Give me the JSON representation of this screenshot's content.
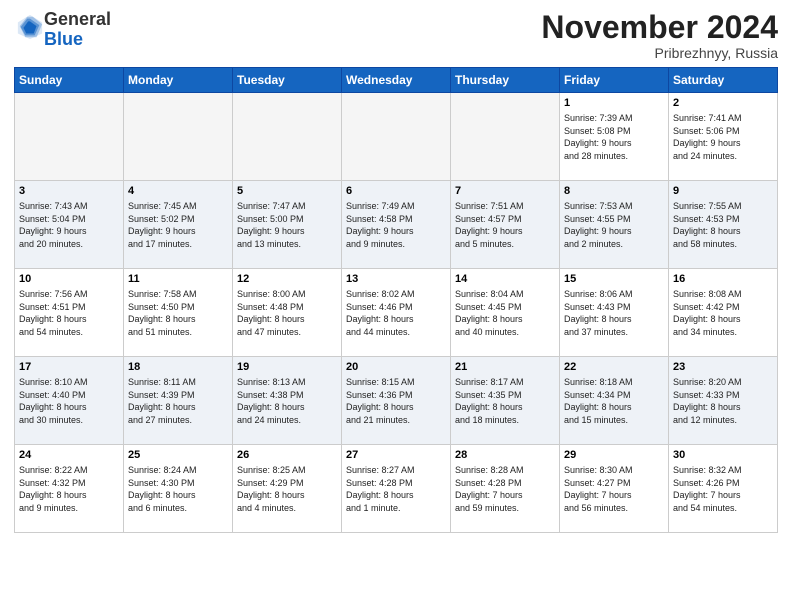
{
  "header": {
    "logo_general": "General",
    "logo_blue": "Blue",
    "month_title": "November 2024",
    "location": "Pribrezhnyy, Russia"
  },
  "weekdays": [
    "Sunday",
    "Monday",
    "Tuesday",
    "Wednesday",
    "Thursday",
    "Friday",
    "Saturday"
  ],
  "weeks": [
    [
      {
        "day": "",
        "info": ""
      },
      {
        "day": "",
        "info": ""
      },
      {
        "day": "",
        "info": ""
      },
      {
        "day": "",
        "info": ""
      },
      {
        "day": "",
        "info": ""
      },
      {
        "day": "1",
        "info": "Sunrise: 7:39 AM\nSunset: 5:08 PM\nDaylight: 9 hours\nand 28 minutes."
      },
      {
        "day": "2",
        "info": "Sunrise: 7:41 AM\nSunset: 5:06 PM\nDaylight: 9 hours\nand 24 minutes."
      }
    ],
    [
      {
        "day": "3",
        "info": "Sunrise: 7:43 AM\nSunset: 5:04 PM\nDaylight: 9 hours\nand 20 minutes."
      },
      {
        "day": "4",
        "info": "Sunrise: 7:45 AM\nSunset: 5:02 PM\nDaylight: 9 hours\nand 17 minutes."
      },
      {
        "day": "5",
        "info": "Sunrise: 7:47 AM\nSunset: 5:00 PM\nDaylight: 9 hours\nand 13 minutes."
      },
      {
        "day": "6",
        "info": "Sunrise: 7:49 AM\nSunset: 4:58 PM\nDaylight: 9 hours\nand 9 minutes."
      },
      {
        "day": "7",
        "info": "Sunrise: 7:51 AM\nSunset: 4:57 PM\nDaylight: 9 hours\nand 5 minutes."
      },
      {
        "day": "8",
        "info": "Sunrise: 7:53 AM\nSunset: 4:55 PM\nDaylight: 9 hours\nand 2 minutes."
      },
      {
        "day": "9",
        "info": "Sunrise: 7:55 AM\nSunset: 4:53 PM\nDaylight: 8 hours\nand 58 minutes."
      }
    ],
    [
      {
        "day": "10",
        "info": "Sunrise: 7:56 AM\nSunset: 4:51 PM\nDaylight: 8 hours\nand 54 minutes."
      },
      {
        "day": "11",
        "info": "Sunrise: 7:58 AM\nSunset: 4:50 PM\nDaylight: 8 hours\nand 51 minutes."
      },
      {
        "day": "12",
        "info": "Sunrise: 8:00 AM\nSunset: 4:48 PM\nDaylight: 8 hours\nand 47 minutes."
      },
      {
        "day": "13",
        "info": "Sunrise: 8:02 AM\nSunset: 4:46 PM\nDaylight: 8 hours\nand 44 minutes."
      },
      {
        "day": "14",
        "info": "Sunrise: 8:04 AM\nSunset: 4:45 PM\nDaylight: 8 hours\nand 40 minutes."
      },
      {
        "day": "15",
        "info": "Sunrise: 8:06 AM\nSunset: 4:43 PM\nDaylight: 8 hours\nand 37 minutes."
      },
      {
        "day": "16",
        "info": "Sunrise: 8:08 AM\nSunset: 4:42 PM\nDaylight: 8 hours\nand 34 minutes."
      }
    ],
    [
      {
        "day": "17",
        "info": "Sunrise: 8:10 AM\nSunset: 4:40 PM\nDaylight: 8 hours\nand 30 minutes."
      },
      {
        "day": "18",
        "info": "Sunrise: 8:11 AM\nSunset: 4:39 PM\nDaylight: 8 hours\nand 27 minutes."
      },
      {
        "day": "19",
        "info": "Sunrise: 8:13 AM\nSunset: 4:38 PM\nDaylight: 8 hours\nand 24 minutes."
      },
      {
        "day": "20",
        "info": "Sunrise: 8:15 AM\nSunset: 4:36 PM\nDaylight: 8 hours\nand 21 minutes."
      },
      {
        "day": "21",
        "info": "Sunrise: 8:17 AM\nSunset: 4:35 PM\nDaylight: 8 hours\nand 18 minutes."
      },
      {
        "day": "22",
        "info": "Sunrise: 8:18 AM\nSunset: 4:34 PM\nDaylight: 8 hours\nand 15 minutes."
      },
      {
        "day": "23",
        "info": "Sunrise: 8:20 AM\nSunset: 4:33 PM\nDaylight: 8 hours\nand 12 minutes."
      }
    ],
    [
      {
        "day": "24",
        "info": "Sunrise: 8:22 AM\nSunset: 4:32 PM\nDaylight: 8 hours\nand 9 minutes."
      },
      {
        "day": "25",
        "info": "Sunrise: 8:24 AM\nSunset: 4:30 PM\nDaylight: 8 hours\nand 6 minutes."
      },
      {
        "day": "26",
        "info": "Sunrise: 8:25 AM\nSunset: 4:29 PM\nDaylight: 8 hours\nand 4 minutes."
      },
      {
        "day": "27",
        "info": "Sunrise: 8:27 AM\nSunset: 4:28 PM\nDaylight: 8 hours\nand 1 minute."
      },
      {
        "day": "28",
        "info": "Sunrise: 8:28 AM\nSunset: 4:28 PM\nDaylight: 7 hours\nand 59 minutes."
      },
      {
        "day": "29",
        "info": "Sunrise: 8:30 AM\nSunset: 4:27 PM\nDaylight: 7 hours\nand 56 minutes."
      },
      {
        "day": "30",
        "info": "Sunrise: 8:32 AM\nSunset: 4:26 PM\nDaylight: 7 hours\nand 54 minutes."
      }
    ]
  ]
}
